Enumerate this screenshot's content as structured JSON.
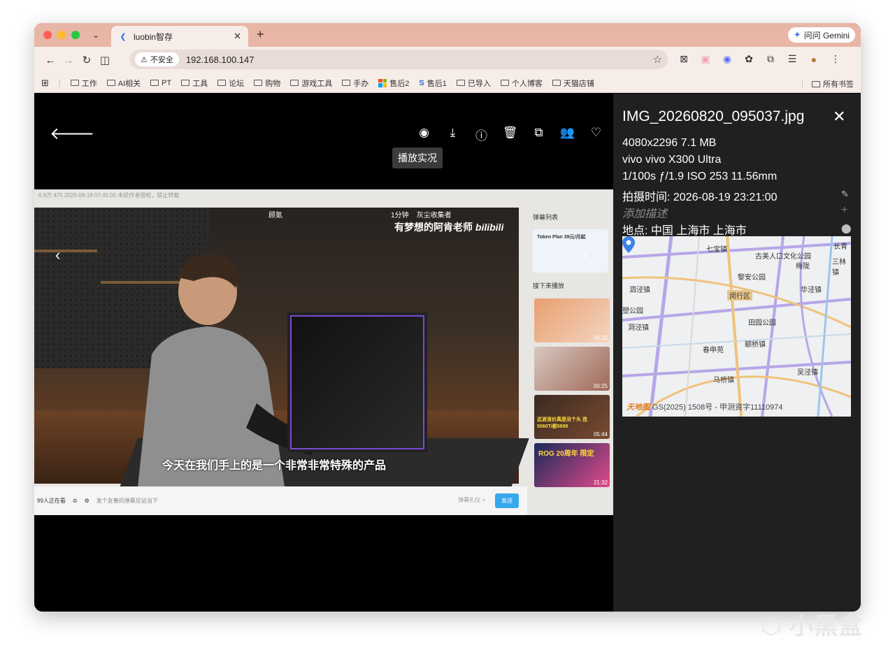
{
  "browser": {
    "tab_search": "⌄",
    "tab_title": "luobin智存",
    "tab_close": "✕",
    "new_tab": "+",
    "gemini_label": "问问 Gemini",
    "security_label": "不安全",
    "url": "192.168.100.147",
    "bookmarks": [
      "工作",
      "AI相关",
      "PT",
      "工具",
      "论坛",
      "购物",
      "游戏工具",
      "手办"
    ],
    "bookmark_ms": "售后2",
    "bookmark_s": "售后1",
    "bookmarks_more": [
      "已导入",
      "个人博客",
      "天猫店铺"
    ],
    "all_bookmarks": "所有书签"
  },
  "viewer": {
    "tooltip": "播放实况",
    "video_overlay": {
      "channel_tag": "有梦想的阿肯老师",
      "brand": "bilibili",
      "top_small_a": "1分钟",
      "top_small_b": "灰尘收集者",
      "top_small_c": "顾氪",
      "subtitle": "今天在我们手上的是一个非常非常特殊的产品",
      "meta_line": "6.8万  475  2026-08-18 07:45:00  未经作者授权，禁止转载",
      "side_header": "弹幕列表",
      "ad_title": "Token Plan 39元/月起",
      "next_label": "接下来播放",
      "thumbs": [
        {
          "dur": "00:25",
          "caption": ""
        },
        {
          "dur": "00:25",
          "caption": ""
        },
        {
          "dur": "05:44",
          "caption": "这波涨价真是没个头 连5060Ti都5999"
        },
        {
          "dur": "21:32",
          "caption": "ROG 20周年 限定"
        }
      ],
      "viewers": "99人正在看",
      "danmu_placeholder": "发个友善的弹幕见证当下",
      "danmu_etiquette": "弹幕礼仪 >",
      "send": "发送"
    }
  },
  "info": {
    "filename": "IMG_20260820_095037.jpg",
    "resolution_size": "4080x2296  7.1 MB",
    "camera": "vivo  vivo X300 Ultra",
    "exposure": "1/100s  ƒ/1.9  ISO 253  11.56mm",
    "taken": "拍摄时间: 2026-08-19 23:21:00",
    "description_placeholder": "添加描述",
    "location": "地点: 中国 上海市 上海市",
    "map_labels": [
      "七宝镇",
      "古美人口文化公园",
      "长青",
      "三林镇",
      "梅陇",
      "黎安公园",
      "华泾镇",
      "泗泾镇",
      "闵行区",
      "塑公园",
      "田园公园",
      "洞泾镇",
      "春申苑",
      "颛桥镇",
      "吴泾镇",
      "马桥镇"
    ],
    "map_footer_brand": "天地图",
    "map_footer": "GS(2025) 1508号 - 甲测资字11110974"
  },
  "site_watermark": "小黑盒"
}
